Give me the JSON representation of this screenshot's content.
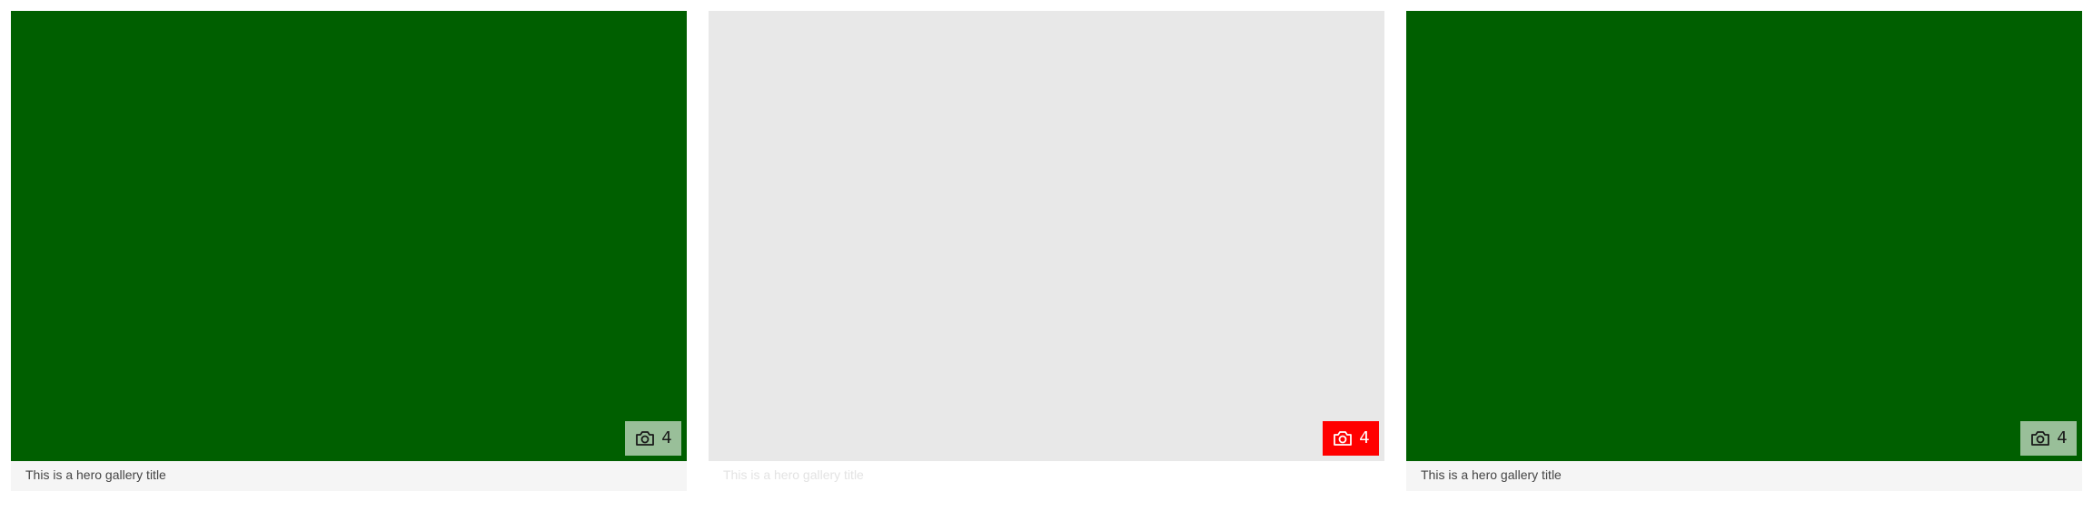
{
  "colors": {
    "image_fill": "#005f00",
    "placeholder_fill": "#e8e8e8",
    "badge_active": "#ff0000",
    "caption_bg": "#f5f5f5"
  },
  "cards": [
    {
      "title": "This is a hero gallery title",
      "photo_count": "4",
      "badge_icon": "camera-icon",
      "state": "loaded"
    },
    {
      "title": "This is a hero gallery title",
      "photo_count": "4",
      "badge_icon": "camera-icon",
      "state": "placeholder"
    },
    {
      "title": "This is a hero gallery title",
      "photo_count": "4",
      "badge_icon": "camera-icon",
      "state": "loaded"
    }
  ]
}
